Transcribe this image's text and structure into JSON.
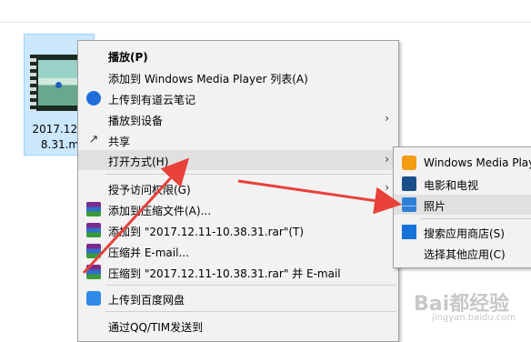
{
  "file": {
    "name_line1": "2017.12.1",
    "name_line2": "8.31.m"
  },
  "context_menu": {
    "items": [
      {
        "label": "播放(P)"
      },
      {
        "label": "添加到 Windows Media Player 列表(A)"
      },
      {
        "label": "上传到有道云笔记"
      },
      {
        "label": "播放到设备"
      },
      {
        "label": "共享"
      },
      {
        "label": "打开方式(H)"
      },
      {
        "label": "授予访问权限(G)"
      },
      {
        "label": "添加到压缩文件(A)..."
      },
      {
        "label": "添加到 \"2017.12.11-10.38.31.rar\"(T)"
      },
      {
        "label": "压缩并 E-mail..."
      },
      {
        "label": "压缩到 \"2017.12.11-10.38.31.rar\" 并 E-mail"
      },
      {
        "label": "上传到百度网盘"
      },
      {
        "label": "通过QQ/TIM发送到"
      }
    ]
  },
  "open_with_submenu": {
    "items": [
      {
        "label": "Windows Media Player"
      },
      {
        "label": "电影和电视"
      },
      {
        "label": "照片"
      },
      {
        "label": "搜索应用商店(S)"
      },
      {
        "label": "选择其他应用(C)"
      }
    ]
  },
  "watermark": {
    "text": "Bai都经验",
    "sub": "jingyan.baidu.com"
  },
  "colors": {
    "annotation_arrow": "#e8413a",
    "selection": "#cce8ff"
  }
}
